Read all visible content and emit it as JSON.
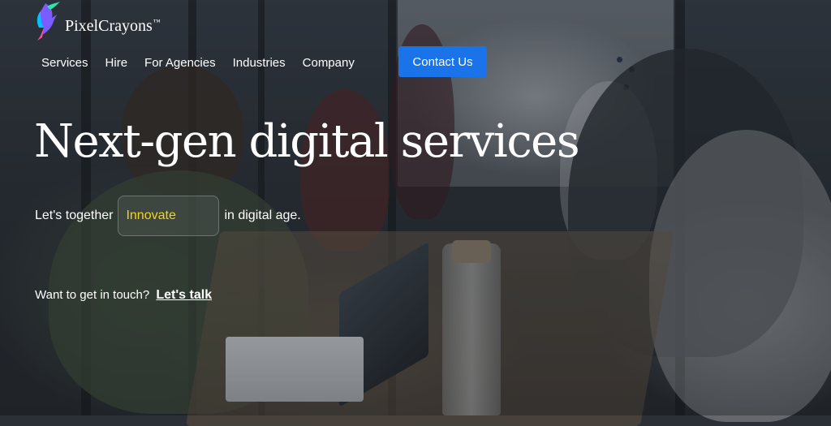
{
  "brand": {
    "name": "PixelCrayons",
    "trademark": "™",
    "logo_icon": "hummingbird-icon"
  },
  "nav": {
    "items": [
      {
        "label": "Services"
      },
      {
        "label": "Hire"
      },
      {
        "label": "For Agencies"
      },
      {
        "label": "Industries"
      },
      {
        "label": "Company"
      }
    ],
    "cta_label": "Contact Us"
  },
  "hero": {
    "title": "Next-gen digital services",
    "tagline_before": "Let's together",
    "tagline_highlight": "Innovate",
    "tagline_after": "in digital age.",
    "touch_prompt": "Want to get in touch?",
    "touch_link": "Let's talk"
  },
  "colors": {
    "accent": "#1a73e8",
    "highlight": "#f5d60f"
  }
}
